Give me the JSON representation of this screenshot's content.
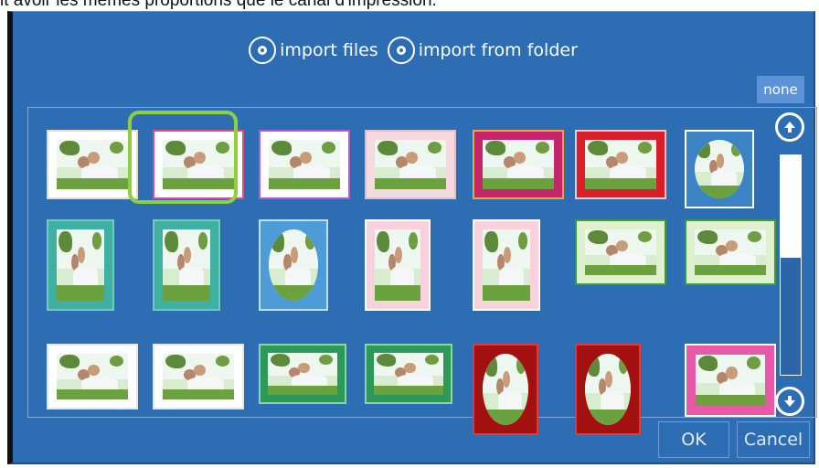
{
  "caption": {
    "text": "it avoir les mêmes proportions que le canal d'impression."
  },
  "dialog": {
    "import_files_label": "import files",
    "import_folder_label": "import from folder",
    "none_label": "none",
    "ok_label": "OK",
    "cancel_label": "Cancel"
  },
  "templates": {
    "rows": [
      [
        {
          "frame": "plain",
          "colors": [
            "#ffffff",
            "#e7ddc3"
          ]
        },
        {
          "frame": "pink flowers",
          "colors": [
            "#ffffff",
            "#e44b86"
          ],
          "selected": true
        },
        {
          "frame": "purple flowers",
          "colors": [
            "#ffffff",
            "#b55bd1"
          ]
        },
        {
          "frame": "pastel",
          "colors": [
            "#f6d9de",
            "#e0bfc8"
          ]
        },
        {
          "frame": "colorful flowers",
          "colors": [
            "#c6256d",
            "#f2a33a"
          ]
        },
        {
          "frame": "red",
          "colors": [
            "#d91e2a",
            "#f0c7d1"
          ]
        },
        {
          "frame": "blue round",
          "colors": [
            "#3b83c4",
            "#ffffff"
          ]
        }
      ],
      [
        {
          "frame": "teal",
          "colors": [
            "#3fb0a2",
            "#73c9bf"
          ]
        },
        {
          "frame": "teal",
          "colors": [
            "#3fb0a2",
            "#73c9bf"
          ]
        },
        {
          "frame": "blue watercolor",
          "colors": [
            "#4d9bd7",
            "#bfe0f6"
          ]
        },
        {
          "frame": "pink sketch",
          "colors": [
            "#f7d2dc",
            "#ffffff"
          ]
        },
        {
          "frame": "pink sketch",
          "colors": [
            "#f7d2dc",
            "#ffffff"
          ]
        },
        {
          "frame": "green",
          "colors": [
            "#dff0cf",
            "#3f9b3a"
          ]
        },
        {
          "frame": "green",
          "colors": [
            "#dff0cf",
            "#3f9b3a"
          ]
        }
      ],
      [
        {
          "frame": "white border",
          "colors": [
            "#ffffff",
            "#e6e6e6"
          ]
        },
        {
          "frame": "white border",
          "colors": [
            "#ffffff",
            "#e6e6e6"
          ]
        },
        {
          "frame": "green border",
          "colors": [
            "#2b9a58",
            "#8ad4a6"
          ]
        },
        {
          "frame": "green border",
          "colors": [
            "#2b9a58",
            "#8ad4a6"
          ]
        },
        {
          "frame": "red roses",
          "colors": [
            "#a31010",
            "#e23a3a"
          ]
        },
        {
          "frame": "red roses",
          "colors": [
            "#a31010",
            "#e23a3a"
          ]
        },
        {
          "frame": "pink ornament",
          "colors": [
            "#e85aa7",
            "#ffffff"
          ]
        }
      ]
    ]
  },
  "scrollbar": {
    "position": 0.0,
    "visible_fraction": 0.45
  }
}
